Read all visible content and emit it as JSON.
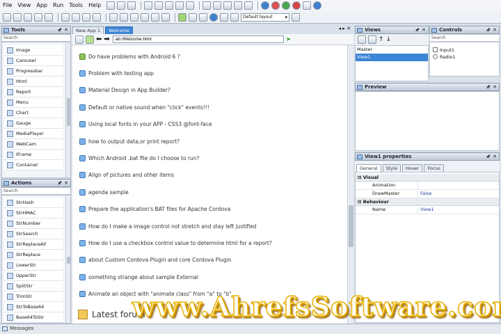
{
  "menu": [
    "File",
    "View",
    "App",
    "Run",
    "Tools",
    "Help"
  ],
  "toolbar": {
    "layout_select": "Default layout"
  },
  "tools": {
    "title": "Tools",
    "search_placeholder": "Search",
    "items": [
      "Image",
      "Carousel",
      "Progressbar",
      "Html",
      "Report",
      "Menu",
      "Chart",
      "Gauge",
      "MediaPlayer",
      "WebCam",
      "IFrame",
      "Container"
    ]
  },
  "actions": {
    "title": "Actions",
    "search_placeholder": "Search",
    "items": [
      "StrHash",
      "StrHMAC",
      "StrNumber",
      "StrSearch",
      "StrReplaceAll",
      "StrReplace",
      "LowerStr",
      "UpperStr",
      "SplitStr",
      "TrimStr",
      "StrToBase64",
      "Base64ToStr"
    ]
  },
  "messages": {
    "label": "Messages"
  },
  "editor": {
    "tabs": [
      "New App 1",
      "Welcome"
    ],
    "active_tab": "Welcome",
    "url": "ab:/Welcome.html",
    "topics": [
      "Do have problems with Android 6 ?",
      "Problem with testing app",
      "Material Design in App Builder?",
      "Default or native sound when \"click\" events!!!",
      "Using local fonts in your APP - CSS3 @font-face",
      "how to output data,or print report?",
      "Which Android .bat file do I choose to run?",
      "Align of pictures and other items",
      "agenda sample",
      "Prepare the application's BAT files for Apache Cordova",
      "How do I make a image control not stretch and stay left justified",
      "How do I use a checkbox control value to determine html for a report?",
      "about Custom Cordova Plugin and core Cordova Plugin",
      "something strange about sample External",
      "Animate an object with \"animate class\" from \"a\" to \"b\""
    ],
    "section_heading": "Latest forum"
  },
  "views": {
    "title": "Views",
    "items": [
      "Master",
      "View1"
    ],
    "selected": "View1"
  },
  "controls": {
    "title": "Controls",
    "search_placeholder": "Search",
    "items": [
      "Input1",
      "Radio1"
    ]
  },
  "preview": {
    "title": "Preview"
  },
  "properties": {
    "title": "View1 properties",
    "tabs": [
      "General",
      "Style",
      "Hover",
      "Focus"
    ],
    "active_tab": "General",
    "visual_label": "Visual",
    "rows_visual": [
      {
        "k": "Animation",
        "v": ""
      },
      {
        "k": "DrawMaster",
        "v": "False"
      }
    ],
    "behaviour_label": "Behaviour",
    "rows_behaviour": [
      {
        "k": "Name",
        "v": "View1"
      }
    ]
  },
  "watermark": "www.AhrefsSoftware.com",
  "colors": {
    "accent": "#3f84d4",
    "selection": "#3b84d6",
    "panel_bg": "#d9e1ea"
  }
}
